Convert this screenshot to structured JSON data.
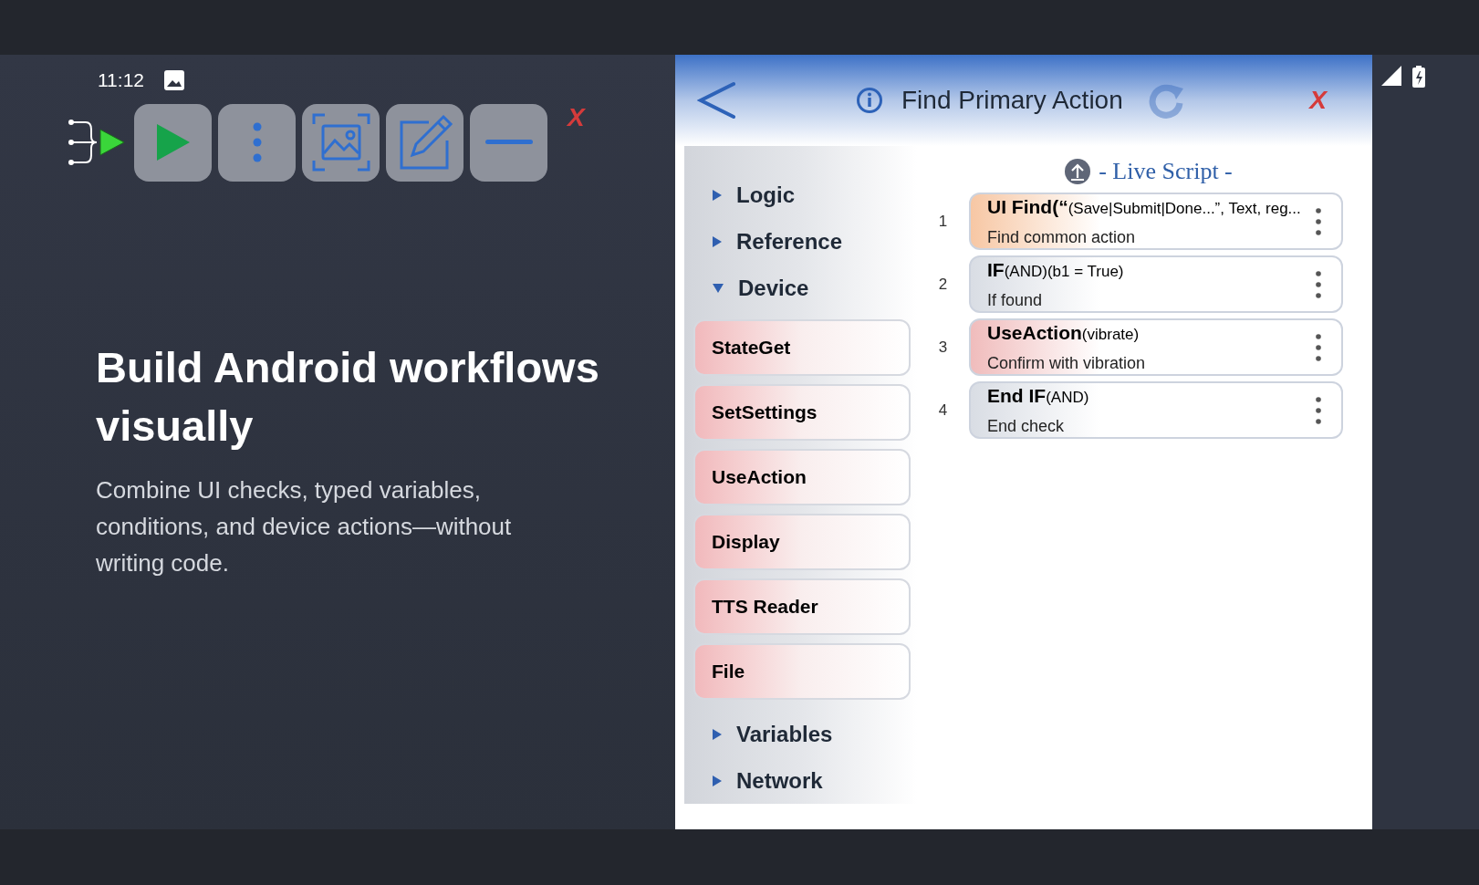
{
  "status_bar": {
    "time": "11:12"
  },
  "toolbar": {
    "buttons": [
      {
        "kind": "play"
      },
      {
        "kind": "more"
      },
      {
        "kind": "capture"
      },
      {
        "kind": "edit"
      },
      {
        "kind": "minimize"
      }
    ],
    "close": "X"
  },
  "hero": {
    "title": "Build Android workflows visually",
    "subtitle": "Combine UI checks, typed variables, conditions, and device actions—without writing code."
  },
  "editor": {
    "title": "Find Primary Action",
    "close": "X",
    "sidebar": [
      {
        "label": "Logic",
        "expanded": false
      },
      {
        "label": "Reference",
        "expanded": false
      },
      {
        "label": "Device",
        "expanded": true,
        "children": [
          {
            "label": "StateGet"
          },
          {
            "label": "SetSettings"
          },
          {
            "label": "UseAction"
          },
          {
            "label": "Display"
          },
          {
            "label": "TTS Reader"
          },
          {
            "label": "File"
          }
        ]
      },
      {
        "label": "Variables",
        "expanded": false
      },
      {
        "label": "Network",
        "expanded": false
      }
    ],
    "script": {
      "heading": "- Live Script -",
      "rows": [
        {
          "number": "1",
          "command": "UI Find(“",
          "args": "(Save|Submit|Done...”, Text, reg...",
          "note": "Find common action",
          "color": "#f7c7a4"
        },
        {
          "number": "2",
          "command": "IF",
          "args": "(AND)(b1 = True)",
          "note": "If found",
          "color": "#d9dde4"
        },
        {
          "number": "3",
          "command": "UseAction",
          "args": "(vibrate)",
          "note": "Confirm with vibration",
          "color": "#f0bcbc"
        },
        {
          "number": "4",
          "command": "End IF",
          "args": "(AND)",
          "note": "End check",
          "color": "#d9dde4"
        }
      ]
    }
  }
}
